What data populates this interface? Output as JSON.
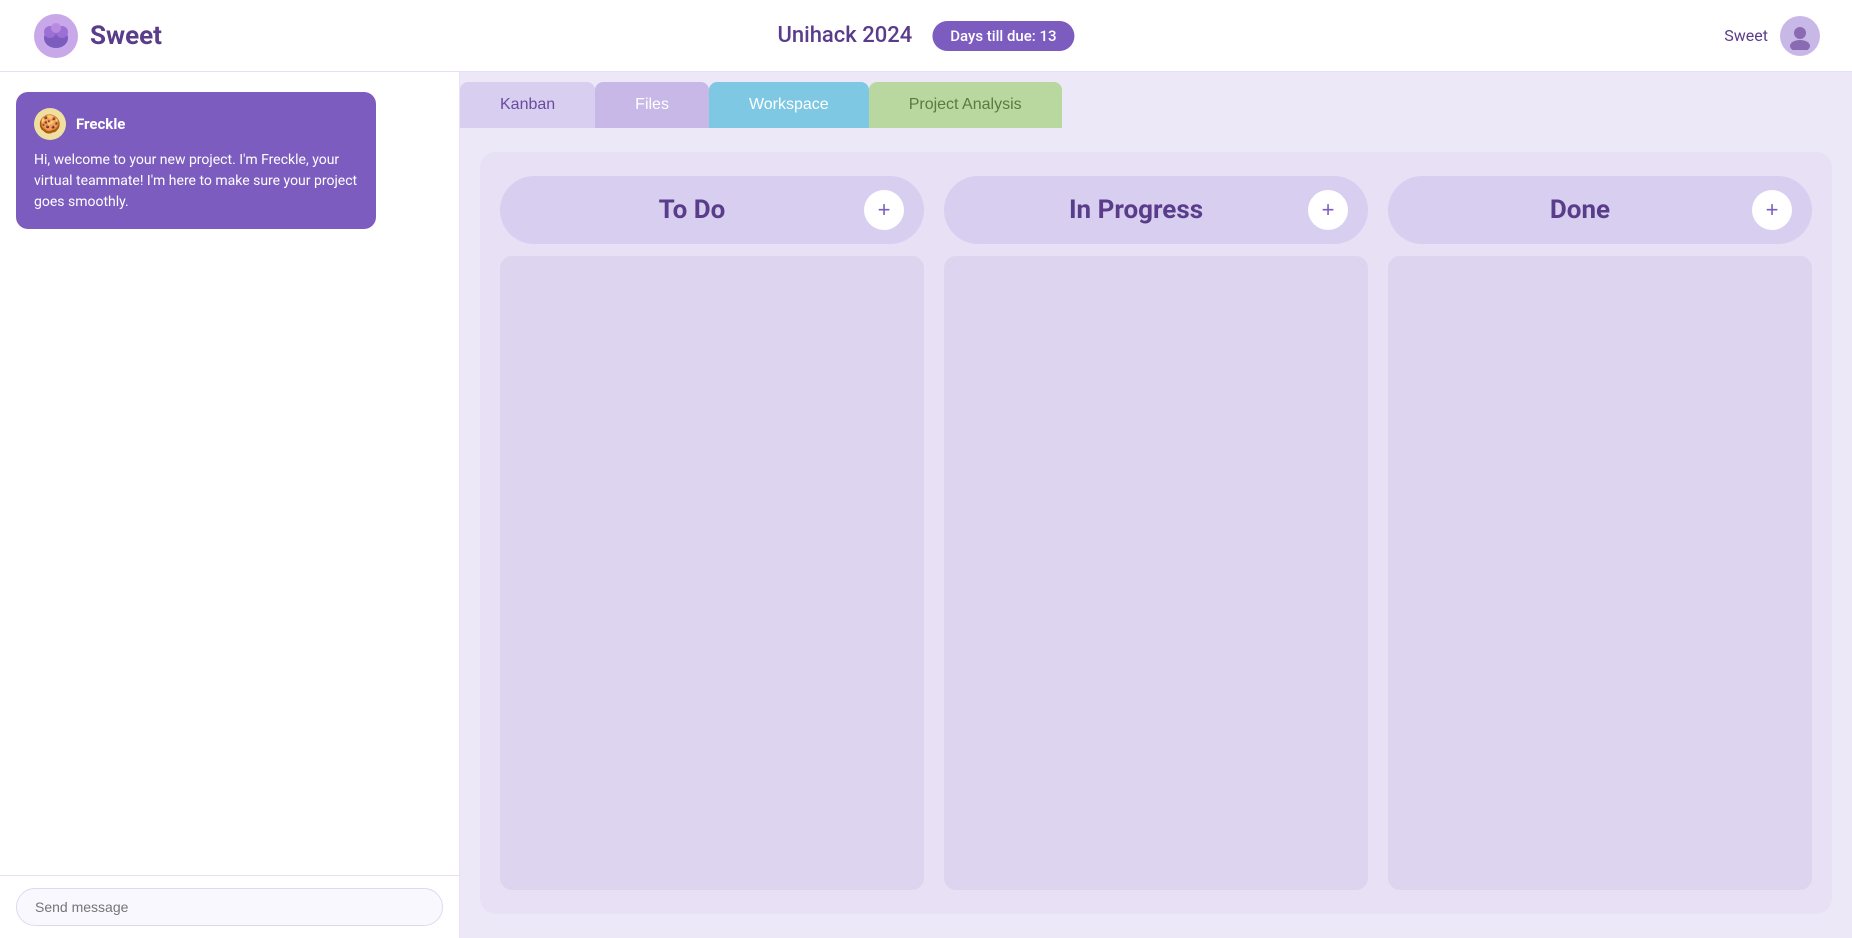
{
  "header": {
    "logo_text": "Sweet",
    "project_title": "Unihack 2024",
    "days_badge": "Days till due: 13",
    "user_name": "Sweet"
  },
  "tabs": [
    {
      "id": "kanban",
      "label": "Kanban",
      "active": false
    },
    {
      "id": "files",
      "label": "Files",
      "active": false
    },
    {
      "id": "workspace",
      "label": "Workspace",
      "active": true
    },
    {
      "id": "project-analysis",
      "label": "Project Analysis",
      "active": false
    }
  ],
  "chat": {
    "bot_name": "Freckle",
    "bot_emoji": "🍪",
    "message": "Hi, welcome to your new project. I'm Freckle, your virtual teammate! I'm here to make sure your project goes smoothly.",
    "input_placeholder": "Send message"
  },
  "kanban": {
    "columns": [
      {
        "id": "todo",
        "title": "To Do",
        "add_label": "+"
      },
      {
        "id": "in-progress",
        "title": "In Progress",
        "add_label": "+"
      },
      {
        "id": "done",
        "title": "Done",
        "add_label": "+"
      }
    ]
  }
}
